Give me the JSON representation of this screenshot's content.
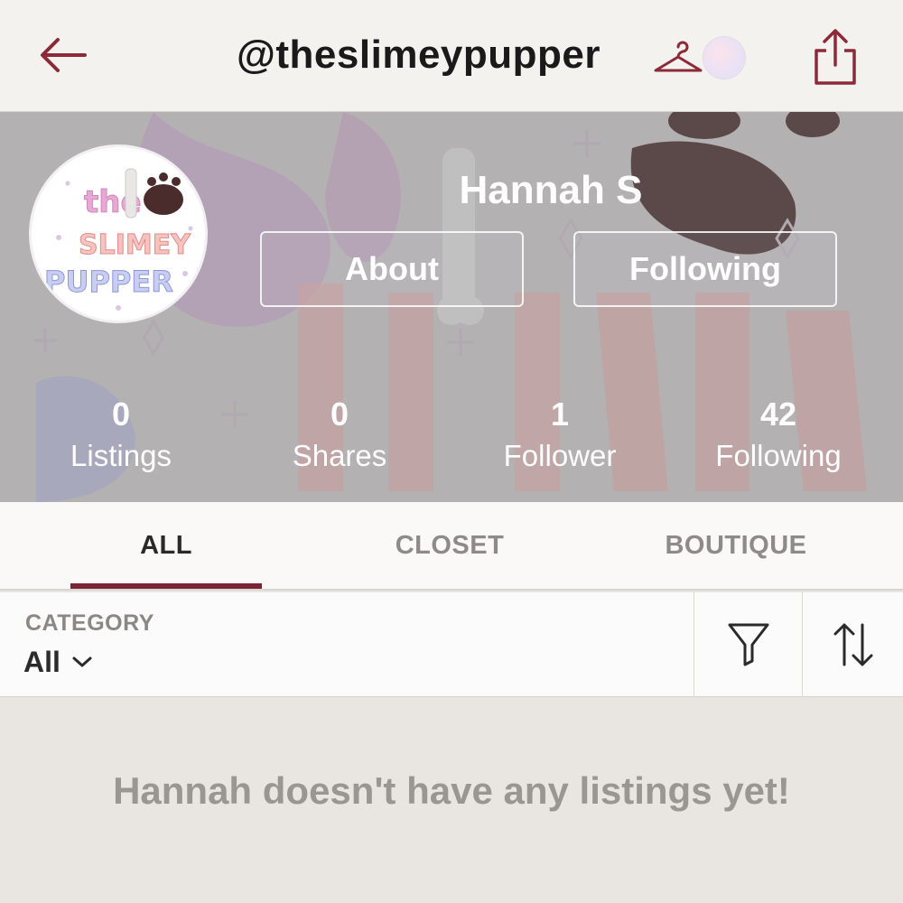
{
  "header": {
    "title": "@theslimeypupper"
  },
  "profile": {
    "name": "Hannah S",
    "about_label": "About",
    "following_label": "Following",
    "avatar_lettering": [
      "the",
      "SLIMEY",
      "PUPPER"
    ],
    "stats": [
      {
        "value": "0",
        "label": "Listings"
      },
      {
        "value": "0",
        "label": "Shares"
      },
      {
        "value": "1",
        "label": "Follower"
      },
      {
        "value": "42",
        "label": "Following"
      }
    ]
  },
  "tabs": {
    "items": [
      {
        "label": "ALL"
      },
      {
        "label": "CLOSET"
      },
      {
        "label": "BOUTIQUE"
      }
    ],
    "active": "ALL"
  },
  "filters": {
    "category_label": "CATEGORY",
    "category_value": "All"
  },
  "empty_state": {
    "message": "Hannah doesn't have any listings yet!"
  },
  "colors": {
    "accent": "#7a2535",
    "topbar_bg": "#f4f2ef",
    "page_bg": "#e9e6e1"
  },
  "icons": [
    "back-arrow-icon",
    "hanger-icon",
    "share-icon",
    "chevron-down-icon",
    "filter-funnel-icon",
    "sort-arrows-icon"
  ]
}
